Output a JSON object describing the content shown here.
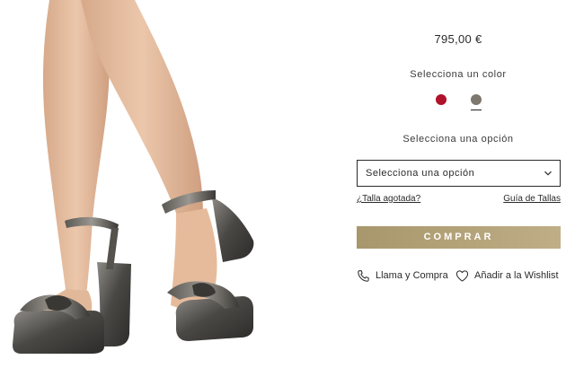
{
  "product": {
    "price": "795,00 €",
    "color_label": "Selecciona un color",
    "colors": [
      {
        "name": "red",
        "hex": "#b0112b",
        "selected": false
      },
      {
        "name": "gunmetal",
        "hex": "#7d776e",
        "selected": true
      }
    ],
    "option_label": "Selecciona una opción",
    "select": {
      "value": "Selecciona una opción",
      "icon": "chevron-down-icon"
    },
    "links": {
      "sold_out": "¿Talla agotada?",
      "size_guide": "Guía de Tallas"
    },
    "buy_button": "COMPRAR",
    "buy_button_color": "#b2a27b",
    "actions": {
      "call": {
        "label": "Llama y Compra",
        "icon": "phone-icon"
      },
      "wishlist": {
        "label": "Añadir a la Wishlist",
        "icon": "heart-icon"
      }
    }
  }
}
